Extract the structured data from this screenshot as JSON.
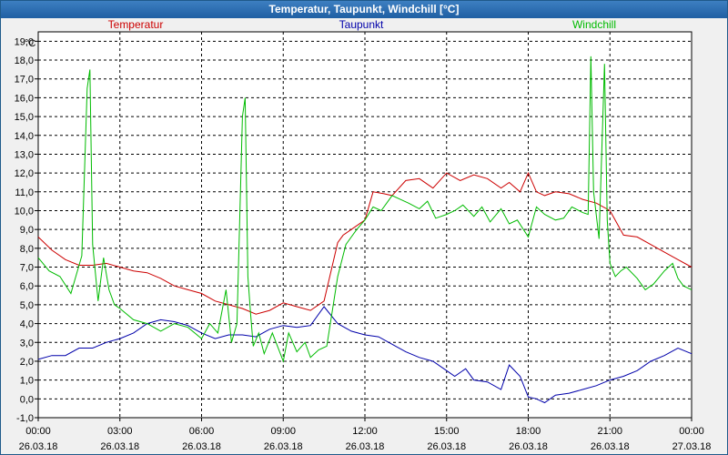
{
  "window": {
    "title": "Temperatur, Taupunkt, Windchill [°C]"
  },
  "chart_data": {
    "type": "line",
    "title": "Temperatur, Taupunkt, Windchill [°C]",
    "ylabel": "°C",
    "ylim": [
      -1,
      19.5
    ],
    "yticks": [
      "19,0",
      "18,0",
      "17,0",
      "16,0",
      "15,0",
      "14,0",
      "13,0",
      "12,0",
      "11,0",
      "10,0",
      "9,0",
      "8,0",
      "7,0",
      "6,0",
      "5,0",
      "4,0",
      "3,0",
      "2,0",
      "1,0",
      "0,0",
      "-1,0"
    ],
    "xlim": [
      0,
      24
    ],
    "xticks": [
      {
        "time": "00:00",
        "date": "26.03.18",
        "h": 0
      },
      {
        "time": "03:00",
        "date": "26.03.18",
        "h": 3
      },
      {
        "time": "06:00",
        "date": "26.03.18",
        "h": 6
      },
      {
        "time": "09:00",
        "date": "26.03.18",
        "h": 9
      },
      {
        "time": "12:00",
        "date": "26.03.18",
        "h": 12
      },
      {
        "time": "15:00",
        "date": "26.03.18",
        "h": 15
      },
      {
        "time": "18:00",
        "date": "26.03.18",
        "h": 18
      },
      {
        "time": "21:00",
        "date": "26.03.18",
        "h": 21
      },
      {
        "time": "00:00",
        "date": "27.03.18",
        "h": 24
      }
    ],
    "grid": true,
    "legend_position": "top",
    "series": [
      {
        "name": "Temperatur",
        "color": "#cc0000",
        "x": [
          0,
          0.5,
          1,
          1.5,
          2,
          2.5,
          3,
          3.5,
          4,
          4.5,
          5,
          5.5,
          6,
          6.5,
          7,
          7.5,
          8,
          8.5,
          9,
          9.5,
          10,
          10.5,
          11,
          11.2,
          11.5,
          12,
          12.3,
          12.7,
          13,
          13.5,
          14,
          14.5,
          15,
          15.5,
          16,
          16.5,
          17,
          17.3,
          17.7,
          18,
          18.3,
          18.6,
          19,
          19.5,
          20,
          20.5,
          21,
          21.5,
          22,
          22.5,
          23,
          23.5,
          24
        ],
        "values": [
          8.6,
          7.9,
          7.4,
          7.1,
          7.1,
          7.2,
          7.0,
          6.8,
          6.7,
          6.4,
          6.0,
          5.8,
          5.6,
          5.2,
          5.0,
          4.8,
          4.5,
          4.7,
          5.1,
          4.9,
          4.7,
          5.2,
          8.3,
          8.7,
          9.0,
          9.5,
          11.0,
          10.9,
          10.8,
          11.6,
          11.7,
          11.2,
          12.0,
          11.6,
          11.9,
          11.7,
          11.2,
          11.5,
          11.0,
          12.0,
          11.0,
          10.8,
          11.0,
          10.9,
          10.6,
          10.4,
          10.0,
          8.7,
          8.6,
          8.2,
          7.8,
          7.4,
          7.0
        ]
      },
      {
        "name": "Taupunkt",
        "color": "#0000aa",
        "x": [
          0,
          0.5,
          1,
          1.5,
          2,
          2.5,
          3,
          3.5,
          4,
          4.5,
          5,
          5.5,
          6,
          6.5,
          7,
          7.5,
          8,
          8.5,
          9,
          9.5,
          10,
          10.5,
          11,
          11.5,
          12,
          12.5,
          13,
          13.5,
          14,
          14.5,
          15,
          15.3,
          15.7,
          16,
          16.5,
          17,
          17.3,
          17.7,
          18,
          18.3,
          18.6,
          19,
          19.5,
          20,
          20.5,
          21,
          21.5,
          22,
          22.5,
          23,
          23.5,
          24
        ],
        "values": [
          2.1,
          2.3,
          2.3,
          2.7,
          2.7,
          3.0,
          3.2,
          3.5,
          4.0,
          4.2,
          4.1,
          3.9,
          3.5,
          3.2,
          3.4,
          3.4,
          3.3,
          3.7,
          3.9,
          3.8,
          3.9,
          4.9,
          4.0,
          3.6,
          3.4,
          3.3,
          2.9,
          2.5,
          2.2,
          2.0,
          1.5,
          1.2,
          1.6,
          1.0,
          0.9,
          0.5,
          1.8,
          1.2,
          0.1,
          0.0,
          -0.2,
          0.2,
          0.3,
          0.5,
          0.7,
          1.0,
          1.2,
          1.5,
          2.0,
          2.3,
          2.7,
          2.4
        ]
      },
      {
        "name": "Windchill",
        "color": "#00bb00",
        "x": [
          0,
          0.4,
          0.8,
          1.2,
          1.6,
          1.8,
          1.9,
          2.0,
          2.2,
          2.4,
          2.6,
          2.8,
          3.0,
          3.5,
          4.0,
          4.5,
          5.0,
          5.5,
          6.0,
          6.3,
          6.6,
          6.9,
          7.1,
          7.3,
          7.5,
          7.6,
          7.7,
          7.8,
          7.9,
          8.1,
          8.3,
          8.6,
          9.0,
          9.2,
          9.5,
          9.8,
          10.0,
          10.3,
          10.6,
          11.0,
          11.3,
          11.7,
          12.0,
          12.3,
          12.6,
          13.0,
          13.3,
          13.6,
          14.0,
          14.3,
          14.6,
          15.0,
          15.3,
          15.6,
          16.0,
          16.3,
          16.6,
          17.0,
          17.3,
          17.6,
          18.0,
          18.3,
          18.6,
          19.0,
          19.3,
          19.6,
          20.0,
          20.2,
          20.3,
          20.4,
          20.6,
          20.8,
          20.9,
          21.0,
          21.2,
          21.4,
          21.6,
          22.0,
          22.3,
          22.6,
          23.0,
          23.3,
          23.5,
          23.7,
          24.0
        ],
        "values": [
          7.5,
          6.8,
          6.5,
          5.6,
          7.6,
          16.5,
          17.5,
          8.2,
          5.2,
          7.5,
          5.8,
          5.0,
          4.8,
          4.2,
          4.0,
          3.6,
          4.0,
          3.8,
          3.2,
          4.0,
          3.5,
          5.8,
          3.0,
          4.0,
          15.0,
          16.0,
          6.5,
          4.5,
          2.8,
          3.5,
          2.4,
          3.5,
          2.0,
          3.5,
          2.5,
          3.0,
          2.2,
          2.6,
          2.8,
          6.5,
          8.2,
          9.0,
          9.5,
          10.2,
          10.0,
          10.8,
          10.6,
          10.4,
          10.1,
          10.5,
          9.6,
          9.8,
          10.0,
          10.3,
          9.7,
          10.2,
          9.4,
          10.1,
          9.3,
          9.5,
          8.6,
          10.2,
          9.8,
          9.5,
          9.6,
          10.2,
          9.9,
          9.8,
          18.2,
          11.0,
          8.5,
          17.8,
          9.5,
          7.2,
          6.5,
          6.8,
          7.0,
          6.4,
          5.8,
          6.1,
          6.8,
          7.2,
          6.4,
          6.0,
          5.8
        ]
      }
    ]
  }
}
